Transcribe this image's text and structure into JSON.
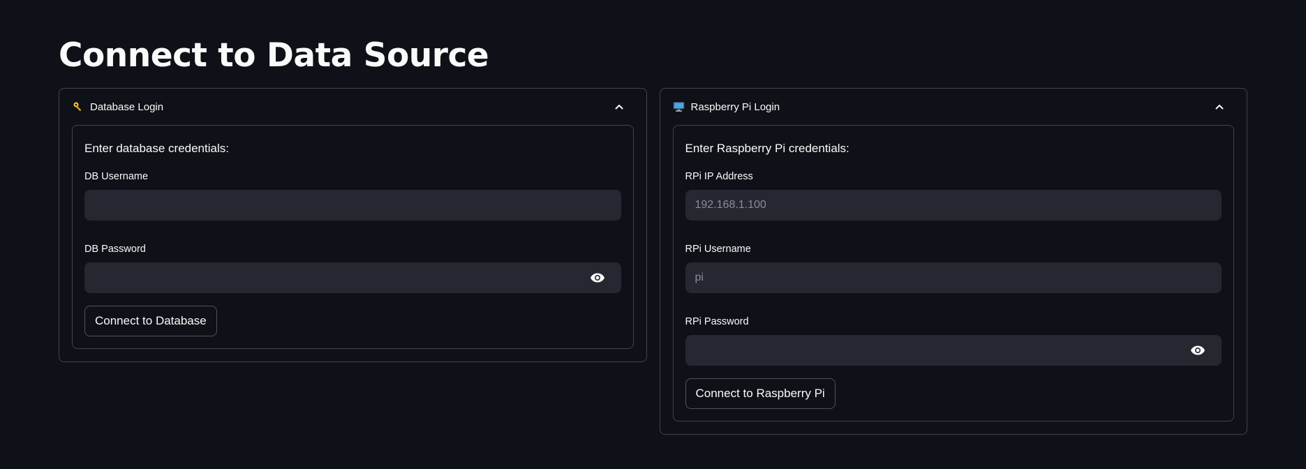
{
  "page": {
    "title": "Connect to Data Source"
  },
  "database": {
    "header": "Database Login",
    "header_icon": "key-icon",
    "subtitle": "Enter database credentials:",
    "username_label": "DB Username",
    "username_value": "",
    "username_placeholder": "",
    "password_label": "DB Password",
    "password_value": "",
    "button_label": "Connect to Database"
  },
  "raspberry": {
    "header": "Raspberry Pi Login",
    "header_icon": "computer-icon",
    "subtitle": "Enter Raspberry Pi credentials:",
    "ip_label": "RPi IP Address",
    "ip_placeholder": "192.168.1.100",
    "username_label": "RPi Username",
    "username_placeholder": "pi",
    "password_label": "RPi Password",
    "password_value": "",
    "button_label": "Connect to Raspberry Pi"
  },
  "colors": {
    "background": "#0e1117",
    "input_background": "#262730",
    "text": "#fafafa",
    "placeholder": "#8b8d95"
  }
}
